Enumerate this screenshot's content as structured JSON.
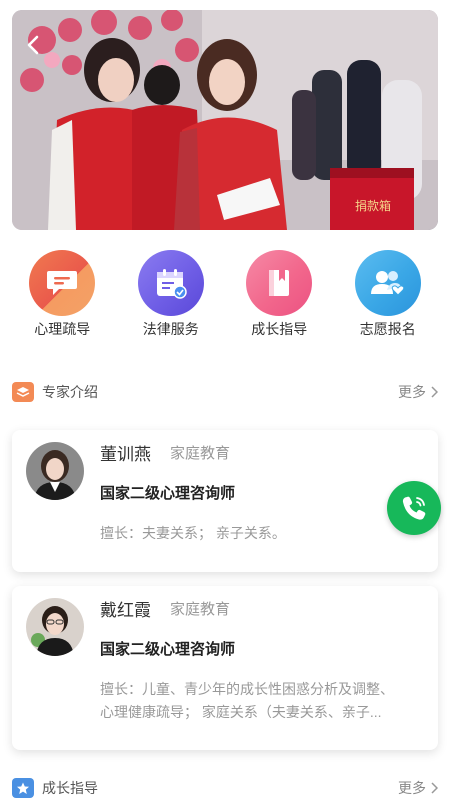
{
  "nav": [
    {
      "label": "心理疏导",
      "icon": "chat-bubble-icon",
      "color": "#ee6a4f"
    },
    {
      "label": "法律服务",
      "icon": "calendar-check-icon",
      "color": "#6f5ee6"
    },
    {
      "label": "成长指导",
      "icon": "book-icon",
      "color": "#f2678c"
    },
    {
      "label": "志愿报名",
      "icon": "people-heart-icon",
      "color": "#3aa7e6"
    }
  ],
  "experts_section": {
    "title": "专家介绍",
    "more": "更多"
  },
  "experts": [
    {
      "name": "董训燕",
      "tag": "家庭教育",
      "title": "国家二级心理咨询师",
      "desc": "擅长：夫妻关系； 亲子关系。"
    },
    {
      "name": "戴红霞",
      "tag": "家庭教育",
      "title": "国家二级心理咨询师",
      "desc_line1": "擅长：儿童、青少年的成长性困惑分析及调整、",
      "desc_line2": "心理健康疏导； 家庭关系（夫妻关系、亲子..."
    }
  ],
  "growth_section": {
    "title": "成长指导",
    "more": "更多"
  },
  "banner": {
    "box_text": "捐款箱"
  }
}
